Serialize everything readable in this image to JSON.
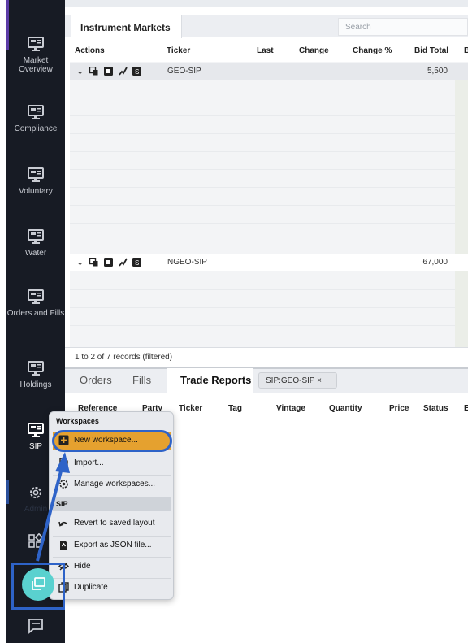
{
  "sidebar": {
    "items": [
      {
        "label": "Market Overview",
        "icon": "monitor-icon"
      },
      {
        "label": "Compliance",
        "icon": "monitor-icon"
      },
      {
        "label": "Voluntary",
        "icon": "monitor-icon"
      },
      {
        "label": "Water",
        "icon": "monitor-icon"
      },
      {
        "label": "Orders and Fills",
        "icon": "monitor-icon"
      },
      {
        "label": "Holdings",
        "icon": "monitor-icon"
      },
      {
        "label": "SIP",
        "icon": "monitor-icon"
      },
      {
        "label": "Admin",
        "icon": "gear-icon"
      }
    ]
  },
  "instrument_panel": {
    "tab_label": "Instrument Markets",
    "search_placeholder": "Search",
    "columns": [
      "Actions",
      "Ticker",
      "Last",
      "Change",
      "Change %",
      "Bid Total",
      "B"
    ],
    "rows": [
      {
        "ticker": "GEO-SIP",
        "bid_total": "5,500"
      },
      {
        "ticker": "NGEO-SIP",
        "bid_total": "67,000"
      }
    ],
    "records_status": "1 to 2 of 7 records (filtered)"
  },
  "bottom_panel": {
    "tabs": [
      "Orders",
      "Fills",
      "Trade Reports"
    ],
    "active_tab": "Trade Reports",
    "filter_chip": "SIP:GEO-SIP ×",
    "columns": [
      "Reference",
      "Party",
      "Ticker",
      "Tag",
      "Vintage",
      "Quantity",
      "Price",
      "Status",
      "E"
    ]
  },
  "context_menu": {
    "section_workspaces": "Workspaces",
    "new_workspace": "New workspace...",
    "import": "Import...",
    "manage_workspaces": "Manage workspaces...",
    "section_sip": "SIP",
    "revert": "Revert to saved layout",
    "export_json": "Export as JSON file...",
    "hide": "Hide",
    "duplicate": "Duplicate"
  },
  "colors": {
    "sidebar_bg": "#171b24",
    "highlight": "#e5a12f",
    "annotation_blue": "#2e63c8",
    "fab_teal": "#5ad1cf"
  }
}
